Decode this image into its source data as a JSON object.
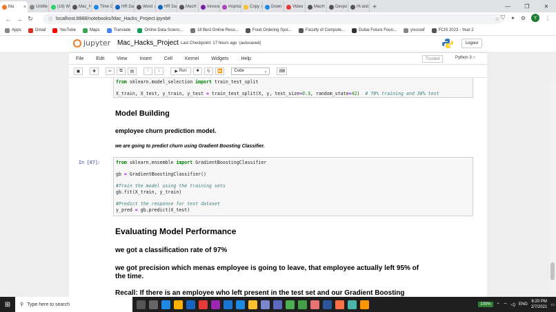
{
  "browser": {
    "tabs": [
      {
        "label": "Ma",
        "color": "#f37726",
        "active": true
      },
      {
        "label": "Untitle",
        "color": "#888888"
      },
      {
        "label": "(18) W",
        "color": "#25d366"
      },
      {
        "label": "Mac_H",
        "color": "#555555"
      },
      {
        "label": "Time C",
        "color": "#1e88e5"
      },
      {
        "label": "HR Da",
        "color": "#1565c0"
      },
      {
        "label": "Word",
        "color": "#555555"
      },
      {
        "label": "HR Da",
        "color": "#1565c0"
      },
      {
        "label": "MacH",
        "color": "#555555"
      },
      {
        "label": "Innova",
        "color": "#7b1fa2"
      },
      {
        "label": "Inspira",
        "color": "#ab47bc"
      },
      {
        "label": "Copy",
        "color": "#fbc02d"
      },
      {
        "label": "Down",
        "color": "#1e88e5"
      },
      {
        "label": "Video",
        "color": "#e53935"
      },
      {
        "label": "MacH",
        "color": "#555555"
      },
      {
        "label": "Devpo",
        "color": "#555555"
      },
      {
        "label": "Hi and",
        "color": "#555555"
      }
    ],
    "new_tab": "+",
    "window_controls": [
      "—",
      "❐",
      "✕"
    ],
    "url": "localhost:8888/notebooks/Mac_Hacks_Project.ipynb#",
    "avatar_letter": "Y",
    "bookmarks": [
      {
        "label": "Apps",
        "color": "#888888"
      },
      {
        "label": "Gmail",
        "color": "#d93025"
      },
      {
        "label": "YouTube",
        "color": "#ff0000"
      },
      {
        "label": "Maps",
        "color": "#34a853"
      },
      {
        "label": "Translate",
        "color": "#4285f4"
      },
      {
        "label": "Online Data Scienc...",
        "color": "#0f9d58"
      },
      {
        "label": "18 Best Online Reso...",
        "color": "#777777"
      },
      {
        "label": "Food Ordering Syst...",
        "color": "#555555"
      },
      {
        "label": "Faculty of Compute...",
        "color": "#555555"
      },
      {
        "label": "Dubai Future Foun...",
        "color": "#333333"
      },
      {
        "label": "youssef",
        "color": "#888888"
      },
      {
        "label": "FCIS 2023 - Year 2",
        "color": "#555555"
      }
    ]
  },
  "jupyter": {
    "logo_text": "jupyter",
    "notebook_title": "Mac_Hacks_Project",
    "checkpoint": "Last Checkpoint: 17 hours ago",
    "autosave": "(autosaved)",
    "logout": "Logout",
    "menu": [
      "File",
      "Edit",
      "View",
      "Insert",
      "Cell",
      "Kernel",
      "Widgets",
      "Help"
    ],
    "trusted": "Trusted",
    "kernel": "Python 3",
    "run_label": "Run",
    "cell_type": "Code"
  },
  "cells": {
    "cell1_line1": {
      "kw": "from",
      "mod": " sklearn.model_selection ",
      "kw2": "import",
      "rest": " train_test_split"
    },
    "cell1_line2": {
      "a": "X_train, X_test, y_train, y_test ",
      "eq": "=",
      "b": " train_test_split(X, y, test_size",
      "eq2": "=",
      "num": "0.3",
      "c": ", random_state",
      "eq3": "=",
      "num2": "42",
      "d": ")  ",
      "comment": "# 70% training and 30% test"
    },
    "heading_model": "Model Building",
    "sub_churn": "employee churn prediction model.",
    "italic_gb": "we are going to predict churn using Gradient Boosting Classifier.",
    "prompt": "In [87]:",
    "cell2_import": {
      "kw": "from",
      "mod": " sklearn.ensemble ",
      "kw2": "import",
      "rest": " GradientBoostingClassifier"
    },
    "cell2_gb": {
      "a": "gb ",
      "eq": "=",
      "b": " GradientBoostingClassifier()"
    },
    "cell2_c1": "#Train the model using the training sets",
    "cell2_fit": "gb.fit(X_train, y_train)",
    "cell2_c2": "#Predict the response for test dataset",
    "cell2_pred": {
      "a": "y_pred ",
      "eq": "=",
      "b": " gb.predict(X_test)"
    },
    "heading_eval": "Evaluating Model Performance",
    "classification": "we got a classification rate of 97%",
    "precision1": "we got precision which menas employee is going to leave, that employee actually left 95% of",
    "precision2": "the time.",
    "recall": "Recall: If there is an employee who left present in the test set and our Gradient Boosting"
  },
  "taskbar": {
    "search_placeholder": "Type here to search",
    "battery": "100%",
    "lang": "ENG",
    "time": "6:20 PM",
    "date": "2/7/2021",
    "app_colors": [
      "#555555",
      "#666666",
      "#1e88e5",
      "#ffb300",
      "#1565c0",
      "#e53935",
      "#9c27b0",
      "#1976d2",
      "#1e88e5",
      "#fbc02d",
      "#7986cb",
      "#5c6bc0",
      "#4caf50",
      "#43a047",
      "#e57373",
      "#2b579a",
      "#ff7043",
      "#4db6ac",
      "#ff9800"
    ]
  }
}
